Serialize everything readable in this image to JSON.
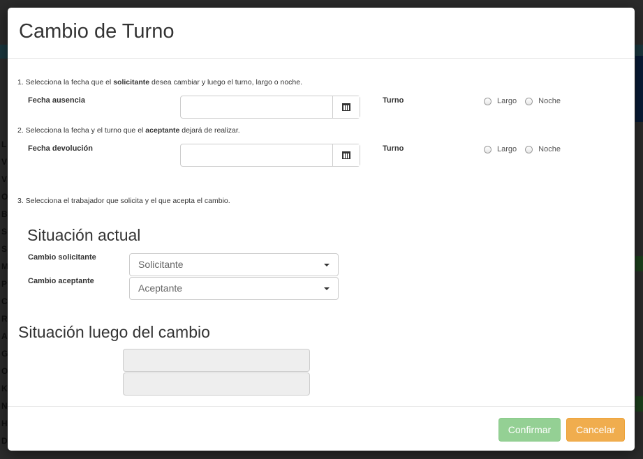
{
  "background": {
    "left_letters": [
      "L",
      "V",
      "V",
      "O",
      "B",
      "S",
      "S",
      "M",
      "P",
      "C",
      "R",
      "A",
      "G",
      "O",
      "K",
      "N",
      "H",
      "D"
    ]
  },
  "modal": {
    "title": "Cambio de Turno",
    "step1": {
      "prefix": "1. Selecciona la fecha que el ",
      "bold": "solicitante",
      "suffix": " desea cambiar y luego el turno, largo o noche."
    },
    "fecha_ausencia_label": "Fecha ausencia",
    "fecha_ausencia_value": "",
    "turno_label_1": "Turno",
    "step2": {
      "prefix": "2. Selecciona la fecha y el turno que el ",
      "bold": "aceptante",
      "suffix": " dejará de realizar."
    },
    "fecha_devolucion_label": "Fecha devolución",
    "fecha_devolucion_value": "",
    "turno_label_2": "Turno",
    "radio_largo": "Largo",
    "radio_noche": "Noche",
    "step3": "3. Selecciona el trabajador que solicita y el que acepta el cambio.",
    "situacion_actual": "Situación actual",
    "cambio_solicitante_label": "Cambio solicitante",
    "solicitante_placeholder": "Solicitante",
    "cambio_aceptante_label": "Cambio aceptante",
    "aceptante_placeholder": "Aceptante",
    "situacion_luego": "Situación luego del cambio",
    "confirm_label": "Confirmar",
    "cancel_label": "Cancelar"
  },
  "colors": {
    "confirm": "#5cb85c",
    "cancel": "#f0ad4e",
    "readonly_bg": "#eeeeee"
  }
}
